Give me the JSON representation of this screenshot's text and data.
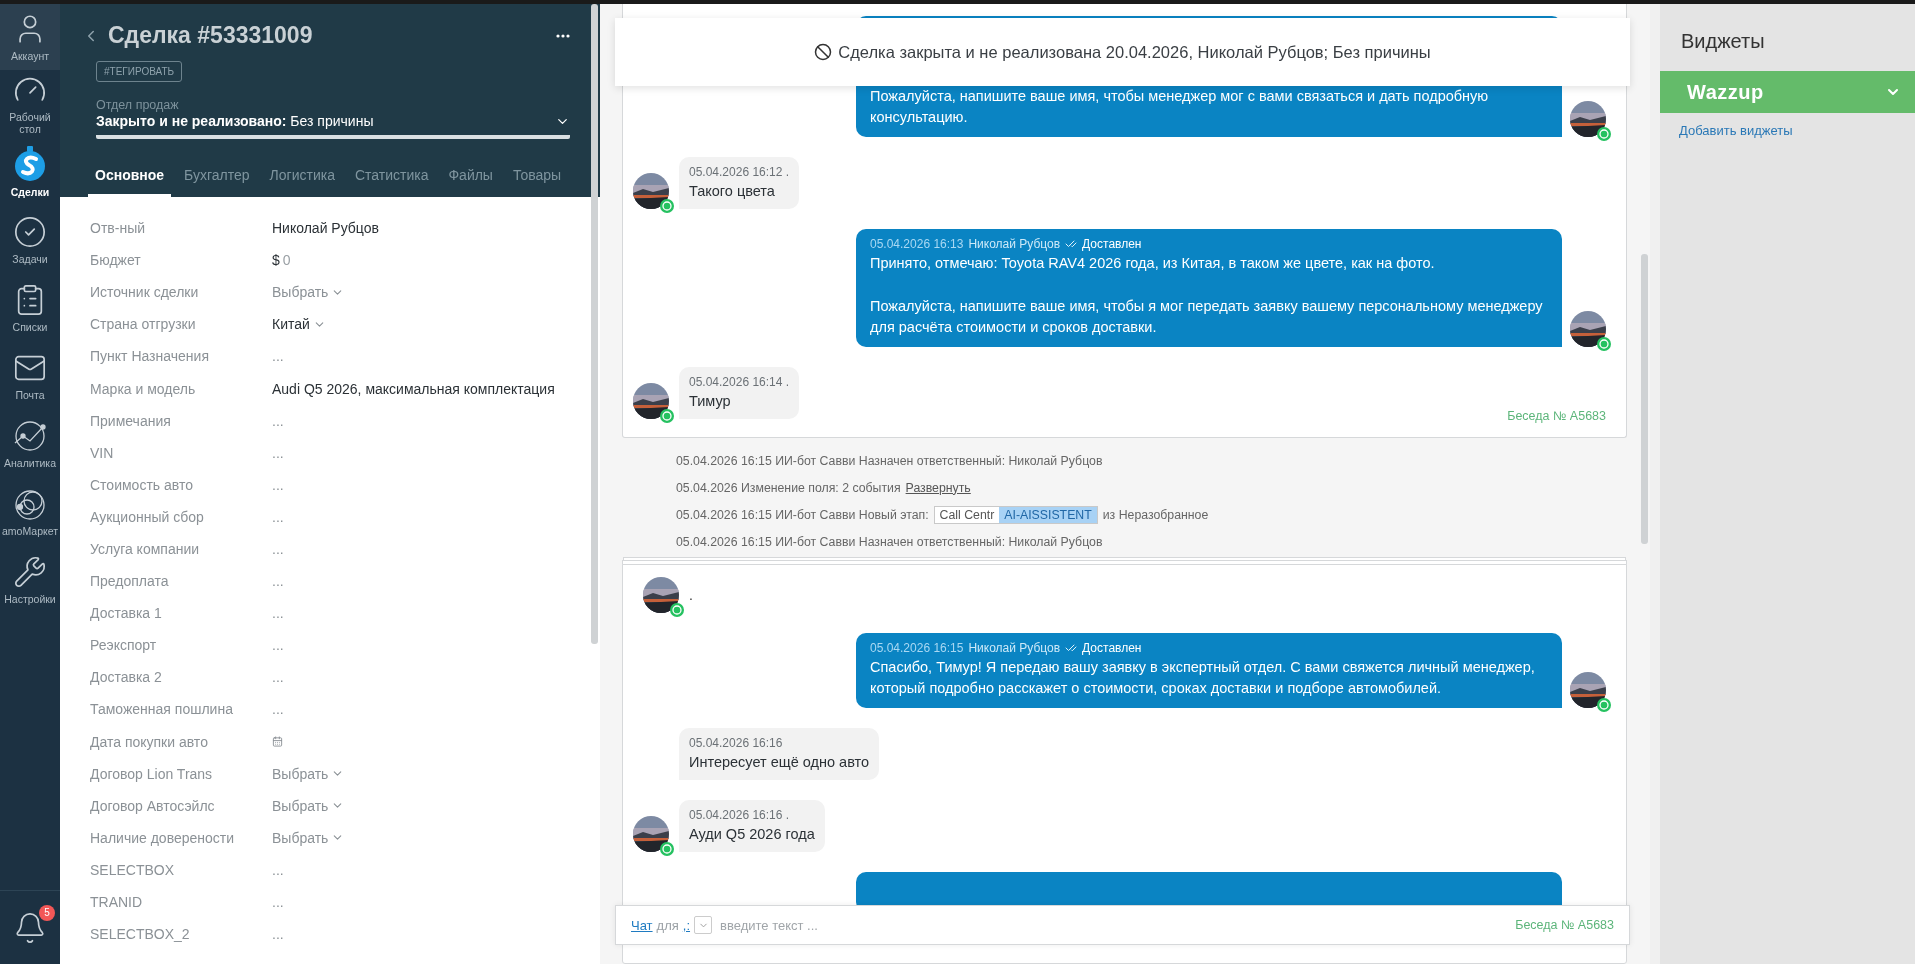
{
  "nav": [
    {
      "label": "Аккаунт",
      "selected": false
    },
    {
      "label": "Рабочий стол",
      "selected": false
    },
    {
      "label": "Сделки",
      "selected": true
    },
    {
      "label": "Задачи",
      "selected": false
    },
    {
      "label": "Списки",
      "selected": false
    },
    {
      "label": "Почта",
      "selected": false
    },
    {
      "label": "Аналитика",
      "selected": false
    },
    {
      "label": "amoМаркет",
      "selected": false
    },
    {
      "label": "Настройки",
      "selected": false
    }
  ],
  "notifications": {
    "count": "5"
  },
  "deal": {
    "title": "Сделка #53331009",
    "tag_button": "#ТЕГИРОВАТЬ",
    "pipeline": "Отдел продаж",
    "status": "**Закрыто и не реализовано:** Без причины",
    "tabs": [
      {
        "label": "Основное",
        "selected": true
      },
      {
        "label": "Бухгалтер",
        "selected": false
      },
      {
        "label": "Логистика",
        "selected": false
      },
      {
        "label": "Статистика",
        "selected": false
      },
      {
        "label": "Файлы",
        "selected": false
      },
      {
        "label": "Товары",
        "selected": false
      }
    ],
    "fields": [
      {
        "label": "Отв-ный",
        "kind": "text",
        "value": "Николай Рубцов"
      },
      {
        "label": "Бюджет",
        "kind": "money",
        "currency": "$",
        "value": "0"
      },
      {
        "label": "Источник сделки",
        "kind": "select",
        "placeholder": "Выбрать"
      },
      {
        "label": "Страна отгрузки",
        "kind": "select",
        "value": "Китай"
      },
      {
        "label": "Пункт Назначения",
        "kind": "empty",
        "value": "..."
      },
      {
        "label": "Марка и модель",
        "kind": "text",
        "value": "Audi Q5 2026, максимальная комплектация"
      },
      {
        "label": "Примечания",
        "kind": "empty",
        "value": "..."
      },
      {
        "label": "VIN",
        "kind": "empty",
        "value": "..."
      },
      {
        "label": "Стоимость авто",
        "kind": "empty",
        "value": "..."
      },
      {
        "label": "Аукционный сбор",
        "kind": "empty",
        "value": "..."
      },
      {
        "label": "Услуга компании",
        "kind": "empty",
        "value": "..."
      },
      {
        "label": "Предоплата",
        "kind": "empty",
        "value": "..."
      },
      {
        "label": "Доставка 1",
        "kind": "empty",
        "value": "..."
      },
      {
        "label": "Реэкспорт",
        "kind": "empty",
        "value": "..."
      },
      {
        "label": "Доставка 2",
        "kind": "empty",
        "value": "..."
      },
      {
        "label": "Таможенная пошлина",
        "kind": "empty",
        "value": "..."
      },
      {
        "label": "Дата покупки авто",
        "kind": "date"
      },
      {
        "label": "Договор Lion Trans",
        "kind": "select",
        "placeholder": "Выбрать"
      },
      {
        "label": "Договор Автосэйлс",
        "kind": "select",
        "placeholder": "Выбрать"
      },
      {
        "label": "Наличие доверености",
        "kind": "select",
        "placeholder": "Выбрать"
      },
      {
        "label": "SELECTBOX",
        "kind": "empty",
        "value": "..."
      },
      {
        "label": "TRANID",
        "kind": "empty",
        "value": "..."
      },
      {
        "label": "SELECTBOX_2",
        "kind": "empty",
        "value": "..."
      }
    ]
  },
  "chat": {
    "banner": "Сделка закрыта и не реализована 20.04.2026, Николай Рубцов; Без причины",
    "cards": [
      {
        "cut_top": true,
        "conversation": "Беседа № A5683",
        "messages": [
          {
            "kind": "outgoing",
            "paragraphs": [
              "Пожалуйста, напишите ваше имя, чтобы менеджер мог с вами связаться и дать подробную консультацию."
            ]
          },
          {
            "kind": "incoming",
            "avatar": true,
            "meta": "05.04.2026 16:12 .",
            "text": "Такого цвета"
          },
          {
            "kind": "outgoing",
            "time": "05.04.2026 16:13",
            "author": "Николай Рубцов",
            "delivery": "Доставлен",
            "paragraphs": [
              "Принято, отмечаю: Toyota RAV4 2026 года, из Китая, в таком же цвете, как на фото.",
              "Пожалуйста, напишите ваше имя, чтобы я мог передать заявку вашему персональному менеджеру для расчёта стоимости и сроков доставки."
            ]
          },
          {
            "kind": "incoming",
            "avatar": true,
            "meta": "05.04.2026 16:14 .",
            "text": "Тимур"
          }
        ]
      },
      {
        "cut_top": false,
        "messages": [
          {
            "kind": "plain",
            "text": "."
          },
          {
            "kind": "outgoing",
            "time": "05.04.2026 16:15",
            "author": "Николай Рубцов",
            "delivery": "Доставлен",
            "paragraphs": [
              "Спасибо, Тимур! Я передаю вашу заявку в экспертный отдел. С вами свяжется личный менеджер, который подробно расскажет о стоимости, сроках доставки и подборе автомобилей."
            ]
          },
          {
            "kind": "incoming",
            "avatar": false,
            "meta": "05.04.2026 16:16",
            "text": "Интересует ещё одно авто"
          },
          {
            "kind": "incoming",
            "avatar": true,
            "meta": "05.04.2026 16:16 .",
            "text": "Ауди Q5 2026 года"
          },
          {
            "kind": "outgoing"
          }
        ]
      }
    ],
    "notes": [
      {
        "kind": "text",
        "text": "05.04.2026 16:15 ИИ-бот Савви Назначен ответственный: Николай Рубцов"
      },
      {
        "kind": "expand",
        "text": "05.04.2026 Изменение поля: 2 события",
        "link": "Развернуть"
      },
      {
        "kind": "stage",
        "text": "05.04.2026 16:15 ИИ-бот Савви Новый этап:",
        "stage_from": "Call Centr",
        "stage_to": "AI-AISSISTENT",
        "suffix": "из Неразобранное"
      },
      {
        "kind": "text",
        "text": "05.04.2026 16:15 ИИ-бот Савви Назначен ответственный: Николай Рубцов"
      }
    ],
    "composer": {
      "channel": "Чат",
      "for": "для",
      "recipient": ",:",
      "placeholder": "введите текст ...",
      "conversation": "Беседа № A5683"
    }
  },
  "widgets": {
    "title": "Виджеты",
    "items": [
      {
        "label": "Wazzup"
      }
    ],
    "add_link": "Добавить виджеты"
  }
}
